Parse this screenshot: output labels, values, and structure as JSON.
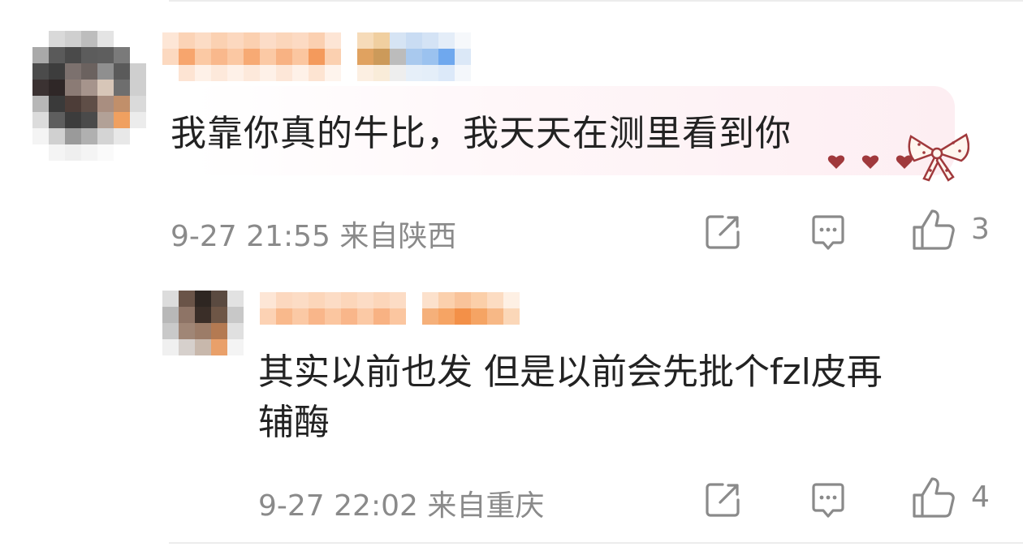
{
  "comments": [
    {
      "text": "我靠你真的牛比，我天天在测里看到你",
      "date": "9-27 21:55",
      "location": "来自陕西",
      "like_count": "3"
    },
    {
      "text_line1": "其实以前也发  但是以前会先批个fzl皮再",
      "text_line2": "辅酶",
      "date": "9-27 22:02",
      "location": "来自重庆",
      "like_count": "4"
    }
  ],
  "icons": {
    "share": "share-icon",
    "comment": "comment-icon",
    "like": "thumbs-up-icon"
  },
  "colors": {
    "text": "#222222",
    "meta": "#8a8a8a",
    "bubble_tint": "#fdeef2",
    "heart": "#a0393c"
  }
}
